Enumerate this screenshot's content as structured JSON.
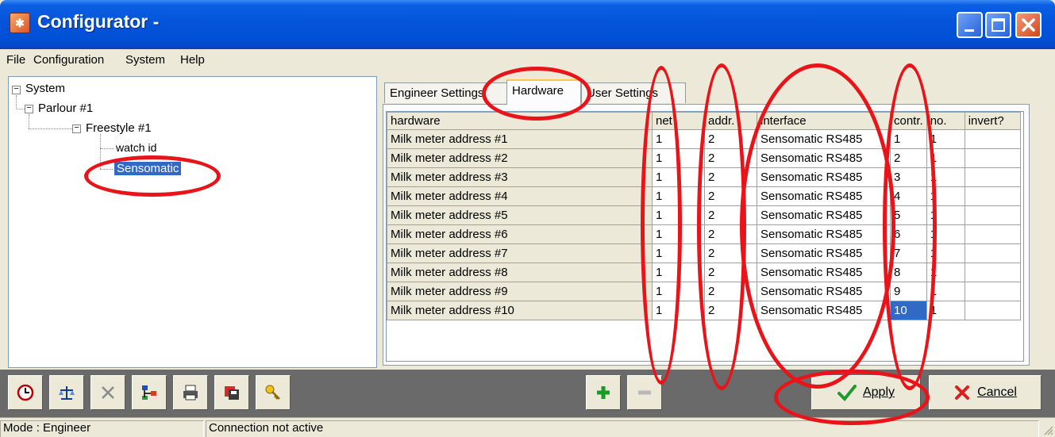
{
  "window": {
    "title": "Configurator -",
    "icon": "app-icon"
  },
  "menu": [
    "File",
    "Configuration",
    "System",
    "Help"
  ],
  "tree": {
    "root": "System",
    "parlour": "Parlour #1",
    "freestyle": "Freestyle #1",
    "watch": "watch id",
    "selected": "Sensomatic"
  },
  "tabs": [
    "Engineer Settings",
    "Hardware",
    "User Settings"
  ],
  "active_tab": "Hardware",
  "grid": {
    "columns": [
      "hardware",
      "net",
      "addr.",
      "interface",
      "contr.",
      "no.",
      "invert?"
    ],
    "rows": [
      [
        "Milk meter address #1",
        "1",
        "2",
        "Sensomatic RS485",
        "1",
        "1",
        ""
      ],
      [
        "Milk meter address #2",
        "1",
        "2",
        "Sensomatic RS485",
        "2",
        "1",
        ""
      ],
      [
        "Milk meter address #3",
        "1",
        "2",
        "Sensomatic RS485",
        "3",
        "1",
        ""
      ],
      [
        "Milk meter address #4",
        "1",
        "2",
        "Sensomatic RS485",
        "4",
        "1",
        ""
      ],
      [
        "Milk meter address #5",
        "1",
        "2",
        "Sensomatic RS485",
        "5",
        "1",
        ""
      ],
      [
        "Milk meter address #6",
        "1",
        "2",
        "Sensomatic RS485",
        "6",
        "1",
        ""
      ],
      [
        "Milk meter address #7",
        "1",
        "2",
        "Sensomatic RS485",
        "7",
        "1",
        ""
      ],
      [
        "Milk meter address #8",
        "1",
        "2",
        "Sensomatic RS485",
        "8",
        "1",
        ""
      ],
      [
        "Milk meter address #9",
        "1",
        "2",
        "Sensomatic RS485",
        "9",
        "1",
        ""
      ],
      [
        "Milk meter address #10",
        "1",
        "2",
        "Sensomatic RS485",
        "10",
        "1",
        ""
      ]
    ],
    "selected_cell_value": "10"
  },
  "toolbar": {
    "icons": [
      "clock-icon",
      "scale-icon",
      "tools-icon",
      "network-icon",
      "printer-icon",
      "save-icon",
      "key-icon"
    ],
    "add_icon": "plus-icon",
    "remove_icon": "minus-icon",
    "apply_label": "Apply",
    "cancel_label": "Cancel"
  },
  "status": {
    "mode": "Mode : Engineer",
    "connection": "Connection not active"
  },
  "colors": {
    "selection": "#316AC5",
    "annotation": "#e8141a",
    "title_bar": "#0453D9"
  }
}
